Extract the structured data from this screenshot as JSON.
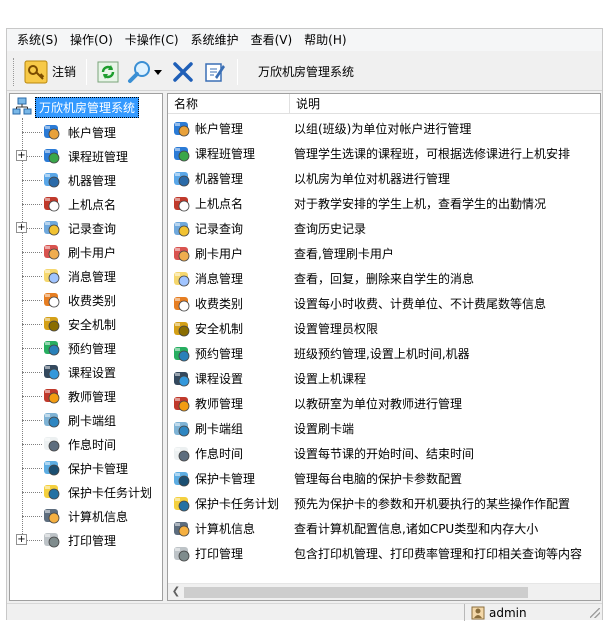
{
  "menu": [
    {
      "label": "系统(S)",
      "icon": ""
    },
    {
      "label": "操作(O)",
      "icon": ""
    },
    {
      "label": "卡操作(C)",
      "icon": ""
    },
    {
      "label": "系统维护",
      "icon": ""
    },
    {
      "label": "查看(V)",
      "icon": ""
    },
    {
      "label": "帮助(H)",
      "icon": ""
    }
  ],
  "toolbar": {
    "logout_label": "注销",
    "title": "万欣机房管理系统"
  },
  "tree": {
    "root": "万欣机房管理系统",
    "items": [
      {
        "label": "帐户管理",
        "icon": "account-icon",
        "expandable": false
      },
      {
        "label": "课程班管理",
        "icon": "course-class-icon",
        "expandable": true
      },
      {
        "label": "机器管理",
        "icon": "computer-icon",
        "expandable": false
      },
      {
        "label": "上机点名",
        "icon": "clock-icon",
        "expandable": false
      },
      {
        "label": "记录查询",
        "icon": "record-search-icon",
        "expandable": true
      },
      {
        "label": "刷卡用户",
        "icon": "card-user-icon",
        "expandable": false
      },
      {
        "label": "消息管理",
        "icon": "message-icon",
        "expandable": false
      },
      {
        "label": "收费类别",
        "icon": "fee-list-icon",
        "expandable": false
      },
      {
        "label": "安全机制",
        "icon": "security-keys-icon",
        "expandable": false
      },
      {
        "label": "预约管理",
        "icon": "reservation-icon",
        "expandable": false
      },
      {
        "label": "课程设置",
        "icon": "course-setting-icon",
        "expandable": false
      },
      {
        "label": "教师管理",
        "icon": "teacher-icon",
        "expandable": false
      },
      {
        "label": "刷卡端组",
        "icon": "card-terminal-icon",
        "expandable": false
      },
      {
        "label": "作息时间",
        "icon": "schedule-icon",
        "expandable": false
      },
      {
        "label": "保护卡管理",
        "icon": "protect-card-icon",
        "expandable": false
      },
      {
        "label": "保护卡任务计划",
        "icon": "protect-plan-icon",
        "expandable": false
      },
      {
        "label": "计算机信息",
        "icon": "computer-info-icon",
        "expandable": false
      },
      {
        "label": "打印管理",
        "icon": "printer-icon",
        "expandable": true
      }
    ]
  },
  "list": {
    "columns": [
      "名称",
      "说明"
    ],
    "rows": [
      {
        "name": "帐户管理",
        "desc": "以组(班级)为单位对帐户进行管理"
      },
      {
        "name": "课程班管理",
        "desc": "管理学生选课的课程班，可根据选修课进行上机安排"
      },
      {
        "name": "机器管理",
        "desc": "以机房为单位对机器进行管理"
      },
      {
        "name": "上机点名",
        "desc": "对于教学安排的学生上机，查看学生的出勤情况"
      },
      {
        "name": "记录查询",
        "desc": "查询历史记录"
      },
      {
        "name": "刷卡用户",
        "desc": "查看,管理刷卡用户"
      },
      {
        "name": "消息管理",
        "desc": "查看，回复，删除来自学生的消息"
      },
      {
        "name": "收费类别",
        "desc": "设置每小时收费、计费单位、不计费尾数等信息"
      },
      {
        "name": "安全机制",
        "desc": "设置管理员权限"
      },
      {
        "name": "预约管理",
        "desc": "班级预约管理,设置上机时间,机器"
      },
      {
        "name": "课程设置",
        "desc": "设置上机课程"
      },
      {
        "name": "教师管理",
        "desc": "以教研室为单位对教师进行管理"
      },
      {
        "name": "刷卡端组",
        "desc": "设置刷卡端"
      },
      {
        "name": "作息时间",
        "desc": "设置每节课的开始时间、结束时间"
      },
      {
        "name": "保护卡管理",
        "desc": "管理每台电脑的保护卡参数配置"
      },
      {
        "name": "保护卡任务计划",
        "desc": "预先为保护卡的参数和开机要执行的某些操作作配置"
      },
      {
        "name": "计算机信息",
        "desc": "查看计算机配置信息,诸如CPU类型和内存大小"
      },
      {
        "name": "打印管理",
        "desc": "包含打印机管理、打印费率管理和打印相关查询等内容"
      }
    ]
  },
  "status": {
    "user": "admin"
  },
  "colors": {
    "selection": "#3399ff",
    "window_bg": "#f0f0f0"
  }
}
